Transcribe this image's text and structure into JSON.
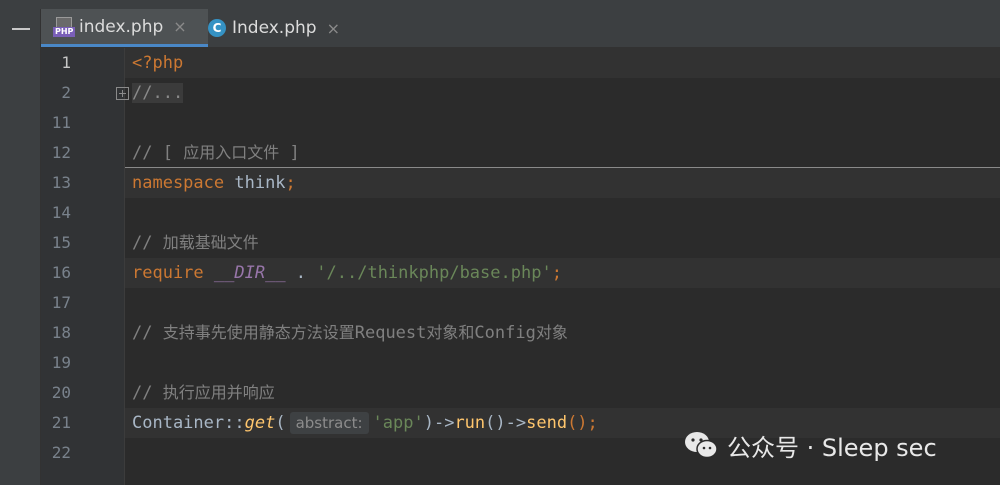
{
  "tabs": [
    {
      "label": "index.php",
      "icon": "php-file-icon",
      "active": true,
      "close": "×"
    },
    {
      "label": "Index.php",
      "icon": "class-icon",
      "icon_letter": "C",
      "active": false,
      "close": "×"
    }
  ],
  "editor": {
    "line_numbers": [
      "1",
      "2",
      "11",
      "12",
      "13",
      "14",
      "15",
      "16",
      "17",
      "18",
      "19",
      "20",
      "21",
      "22"
    ],
    "code": {
      "l1": "<?php",
      "l2": "//...",
      "l12_prefix": "// [ ",
      "l12_text": "应用入口文件",
      "l12_suffix": " ]",
      "l13_kw": "namespace",
      "l13_name": " think",
      "l13_semi": ";",
      "l15_prefix": "// ",
      "l15_text": "加载基础文件",
      "l16_kw": "require",
      "l16_const": "__DIR__",
      "l16_dot": " . ",
      "l16_str": "'/../thinkphp/base.php'",
      "l16_semi": ";",
      "l18_prefix": "// ",
      "l18_a": "支持事先使用静态方法设置",
      "l18_b": "Request",
      "l18_c": "对象和",
      "l18_d": "Config",
      "l18_e": "对象",
      "l20_prefix": "// ",
      "l20_text": "执行应用并响应",
      "l21_class": "Container",
      "l21_sep": "::",
      "l21_get": "get",
      "l21_open": "(",
      "l21_hint": "abstract:",
      "l21_str": "'app'",
      "l21_arrow1": ")->",
      "l21_run": "run",
      "l21_arrow2": "()->",
      "l21_send": "send",
      "l21_end": "();"
    }
  },
  "watermark": {
    "text": "公众号 · Sleep sec",
    "icon": "wechat-icon"
  },
  "colors": {
    "keyword": "#cc7832",
    "string": "#6a8759",
    "comment": "#808080",
    "constant": "#9876aa",
    "method": "#ffc66d",
    "text": "#a9b7c6",
    "tab_active_underline": "#4a88c7"
  }
}
